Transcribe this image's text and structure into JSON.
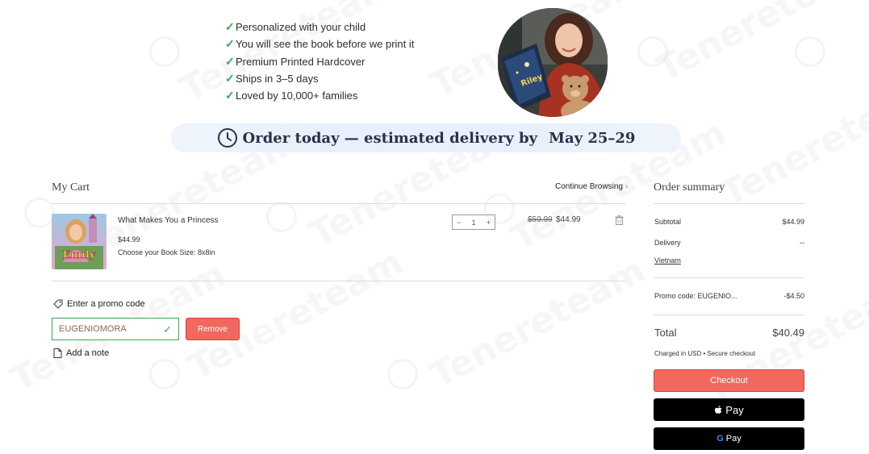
{
  "watermark": {
    "text": "Tenereteam"
  },
  "benefits": [
    "Personalized with your child",
    "You will see the book before we print it",
    "Premium Printed Hardcover",
    "Ships in 3–5 days",
    "Loved by 10,000+ families"
  ],
  "benefit_check": "✓",
  "hero": {
    "book_name": "Riley"
  },
  "banner": {
    "text": "Order today — estimated delivery by",
    "date": "May 25–29"
  },
  "cart": {
    "title": "My Cart",
    "continue_label": "Continue Browsing",
    "continue_chevron": "›",
    "item": {
      "title": "What Makes You a Princess",
      "price": "$44.99",
      "book_size": "Choose your Book Size: 8x8in",
      "cover_name": "Emily",
      "quantity": "1",
      "minus": "−",
      "plus": "+",
      "old_price": "$59.99",
      "new_price": "$44.99"
    },
    "promo_label": "Enter a promo code",
    "promo_value": "EUGENIOMORA",
    "promo_ok": "✓",
    "remove_label": "Remove",
    "note_label": "Add a note"
  },
  "summary": {
    "title": "Order summary",
    "subtotal_label": "Subtotal",
    "subtotal_value": "$44.99",
    "delivery_label": "Delivery",
    "delivery_value": "--",
    "delivery_country": "Vietnam",
    "promo_label": "Promo code: EUGENIO...",
    "promo_value": "-$4.50",
    "total_label": "Total",
    "total_value": "$40.49",
    "charged_note": "Charged in USD • Secure checkout",
    "checkout_label": "Checkout",
    "apple_pay_label": "Pay",
    "apple_glyph": "",
    "google_pay_label": "Pay",
    "google_glyph": "G"
  },
  "colors": {
    "accent": "#f2685e",
    "check_green": "#3aa557",
    "banner_bg": "#e9f0fb",
    "banner_text": "#25324a"
  }
}
